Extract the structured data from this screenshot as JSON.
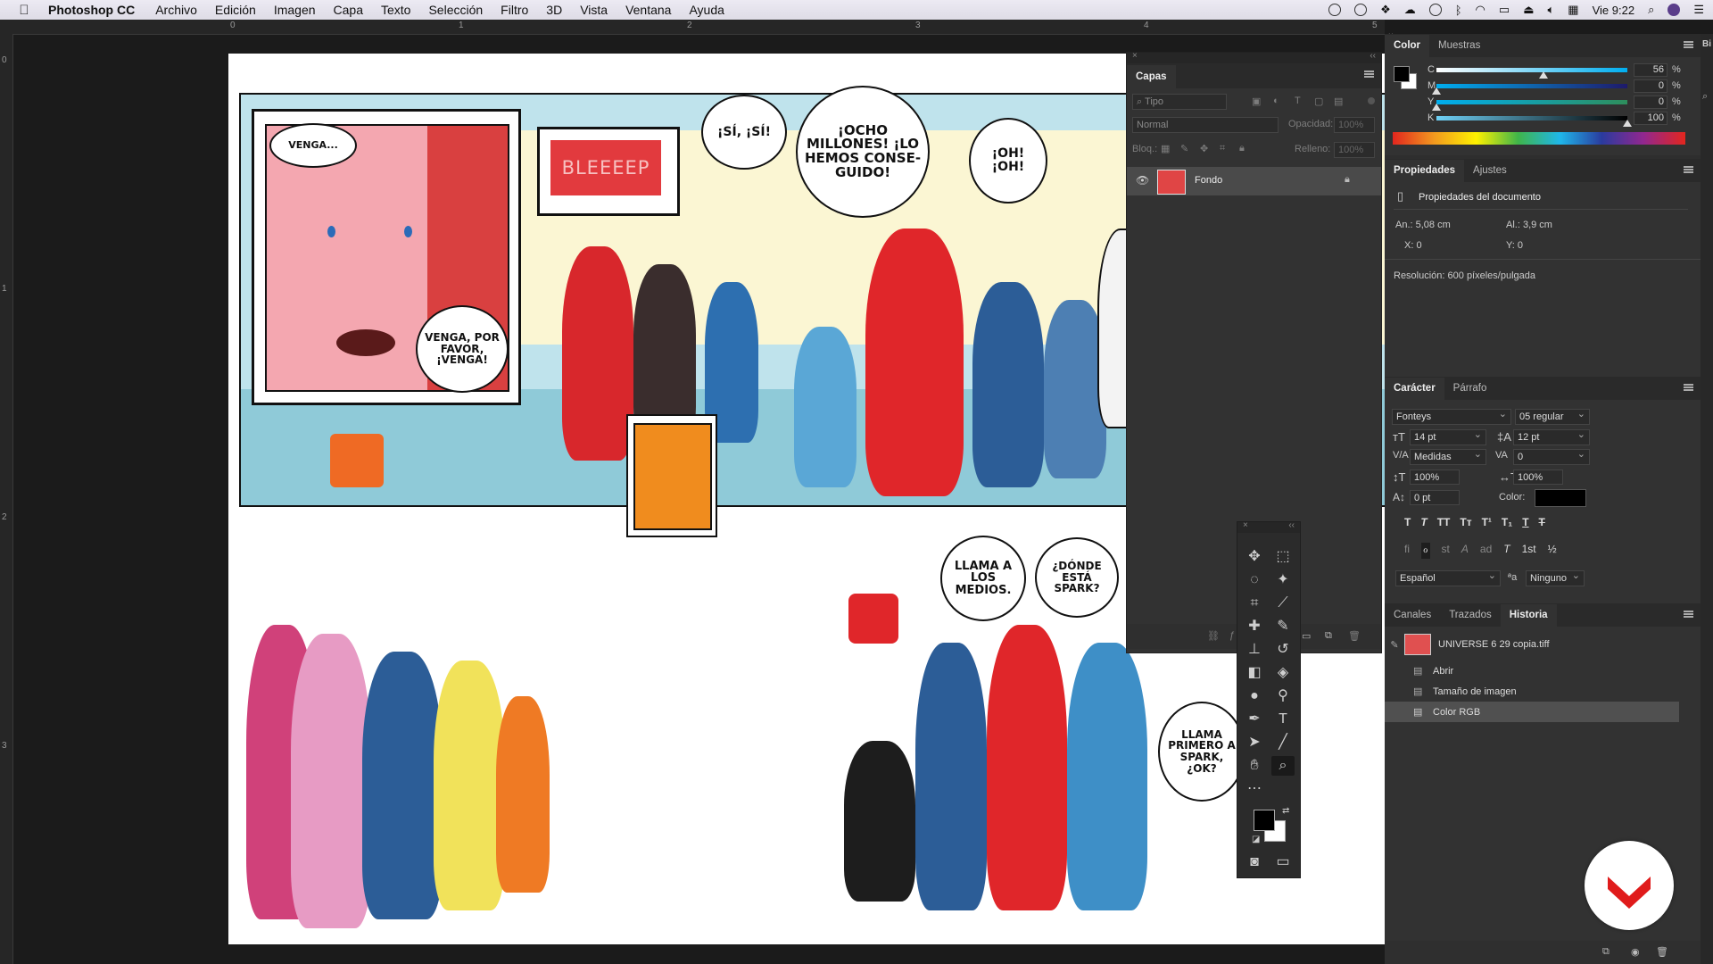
{
  "menubar": {
    "app": "Photoshop CC",
    "items": [
      "Archivo",
      "Edición",
      "Imagen",
      "Capa",
      "Texto",
      "Selección",
      "Filtro",
      "3D",
      "Vista",
      "Ventana",
      "Ayuda"
    ],
    "clock": "Vie 9:22"
  },
  "rulers": {
    "top": [
      "0",
      "1",
      "2",
      "3",
      "4",
      "5"
    ],
    "left": [
      "0",
      "1",
      "2",
      "3"
    ]
  },
  "comic": {
    "b1": "VENGA...",
    "b2": "VENGA, POR FAVOR, ¡VENGA!",
    "b3": "BLEEEEP",
    "b4": "¡SÍ, ¡SÍ!",
    "b5": "¡OCHO MILLONES! ¡LO HEMOS CONSE-GUIDO!",
    "b6": "¡OH! ¡OH!",
    "b7": "LLAMA A LOS MEDIOS.",
    "b8": "¿DÓNDE ESTÁ SPARK?",
    "b9": "LLAMA PRIMERO A SPARK, ¿OK?"
  },
  "layers": {
    "tab": "Capas",
    "filter_placeholder": "Tipo",
    "blend": "Normal",
    "opacity_label": "Opacidad:",
    "opacity_value": "100%",
    "lock_label": "Bloq.:",
    "fill_label": "Relleno:",
    "fill_value": "100%",
    "layer_name": "Fondo"
  },
  "color": {
    "tabs": [
      "Color",
      "Muestras"
    ],
    "channels": [
      {
        "label": "C",
        "value": "56",
        "level": 0.56,
        "pct": "%"
      },
      {
        "label": "M",
        "value": "0",
        "level": 0,
        "pct": "%"
      },
      {
        "label": "Y",
        "value": "0",
        "level": 0,
        "pct": "%"
      },
      {
        "label": "K",
        "value": "100",
        "level": 1,
        "pct": "%"
      }
    ]
  },
  "properties": {
    "tabs": [
      "Propiedades",
      "Ajustes"
    ],
    "title": "Propiedades del documento",
    "an": "An.: 5,08 cm",
    "al": "Al.: 3,9 cm",
    "x": "X: 0",
    "y": "Y: 0",
    "resolution": "Resolución: 600 píxeles/pulgada"
  },
  "character": {
    "tabs": [
      "Carácter",
      "Párrafo"
    ],
    "font": "Fonteys",
    "style": "05 regular",
    "size": "14 pt",
    "leading": "12 pt",
    "kerning": "Medidas",
    "tracking": "0",
    "vscale": "100%",
    "hscale": "100%",
    "baseline": "0 pt",
    "color_label": "Color:",
    "language": "Español",
    "antialias": "Ninguno",
    "style_buttons": [
      "T",
      "T",
      "TT",
      "Tт",
      "T¹",
      "T₁",
      "T",
      "T"
    ],
    "ot_buttons": [
      "ﬁ",
      "ℴ",
      "st",
      "A",
      "ad",
      "T",
      "1st",
      "½"
    ]
  },
  "history": {
    "tabs": [
      "Canales",
      "Trazados",
      "Historia"
    ],
    "snapshot": "UNIVERSE 6 29 copia.tiff",
    "steps": [
      "Abrir",
      "Tamaño de imagen",
      "Color RGB"
    ]
  },
  "side_label": "Bi"
}
